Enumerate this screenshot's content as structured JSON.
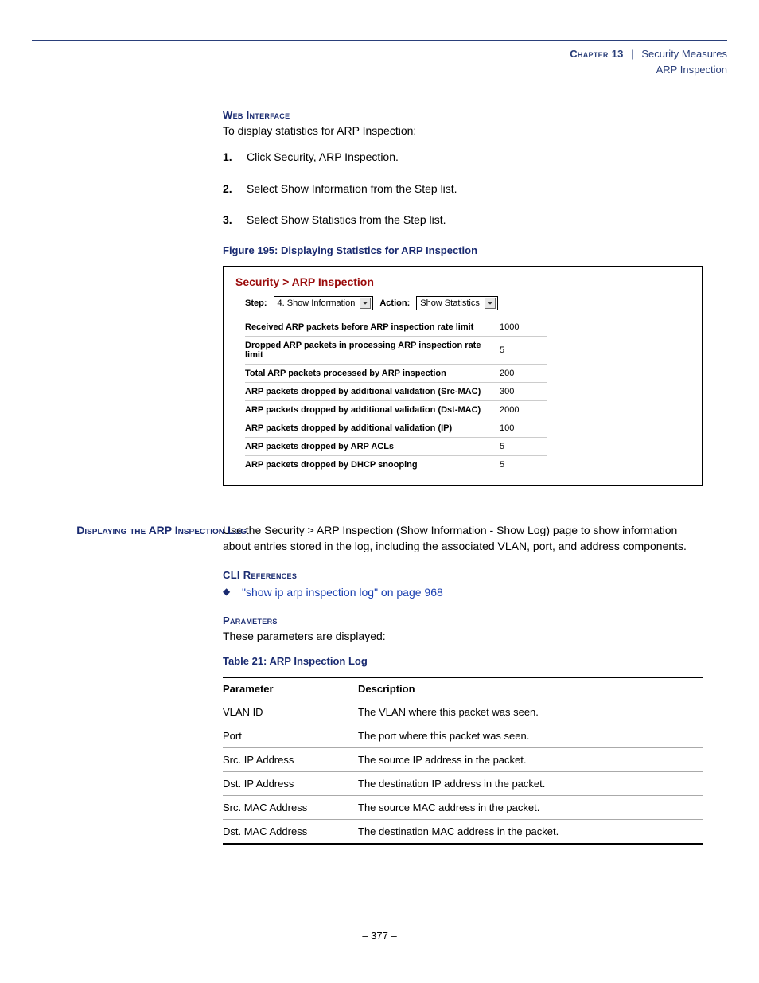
{
  "header": {
    "chapter_label": "Chapter 13",
    "separator": "|",
    "subject": "Security Measures",
    "subsection": "ARP Inspection"
  },
  "webInterface": {
    "heading": "Web Interface",
    "intro": "To display statistics for ARP Inspection:",
    "steps": [
      "Click Security, ARP Inspection.",
      "Select Show Information from the Step list.",
      "Select Show Statistics from the Step list."
    ]
  },
  "figure": {
    "caption": "Figure 195:  Displaying Statistics for ARP Inspection",
    "breadcrumb": "Security > ARP Inspection",
    "step_label": "Step:",
    "step_value": "4. Show Information",
    "action_label": "Action:",
    "action_value": "Show Statistics",
    "rows": [
      {
        "label": "Received ARP packets before ARP inspection rate limit",
        "value": "1000"
      },
      {
        "label": "Dropped ARP packets in processing ARP inspection rate limit",
        "value": "5"
      },
      {
        "label": "Total ARP packets processed by ARP inspection",
        "value": "200"
      },
      {
        "label": "ARP packets dropped by additional validation (Src-MAC)",
        "value": "300"
      },
      {
        "label": "ARP packets dropped by additional validation (Dst-MAC)",
        "value": "2000"
      },
      {
        "label": "ARP packets dropped by additional validation (IP)",
        "value": "100"
      },
      {
        "label": "ARP packets dropped by ARP ACLs",
        "value": "5"
      },
      {
        "label": "ARP packets dropped by DHCP snooping",
        "value": "5"
      }
    ]
  },
  "section2": {
    "margin_heading": "Displaying the ARP Inspection Log",
    "intro": "Use the Security > ARP Inspection (Show Information - Show Log) page to show information about entries stored in the log, including the associated VLAN, port, and address components.",
    "cli_heading": "CLI References",
    "cli_link": "\"show ip arp inspection log\" on page 968",
    "params_heading": "Parameters",
    "params_intro": "These parameters are displayed:",
    "table_caption": "Table 21: ARP Inspection Log",
    "table_headers": {
      "param": "Parameter",
      "desc": "Description"
    },
    "table_rows": [
      {
        "param": "VLAN ID",
        "desc": "The VLAN where this packet was seen."
      },
      {
        "param": "Port",
        "desc": "The port where this packet was seen."
      },
      {
        "param": "Src. IP Address",
        "desc": "The source IP address in the packet."
      },
      {
        "param": "Dst. IP Address",
        "desc": "The destination IP address in the packet."
      },
      {
        "param": "Src. MAC Address",
        "desc": "The source MAC address in the packet."
      },
      {
        "param": "Dst. MAC Address",
        "desc": "The destination MAC address in the packet."
      }
    ]
  },
  "page_number": "–  377  –"
}
